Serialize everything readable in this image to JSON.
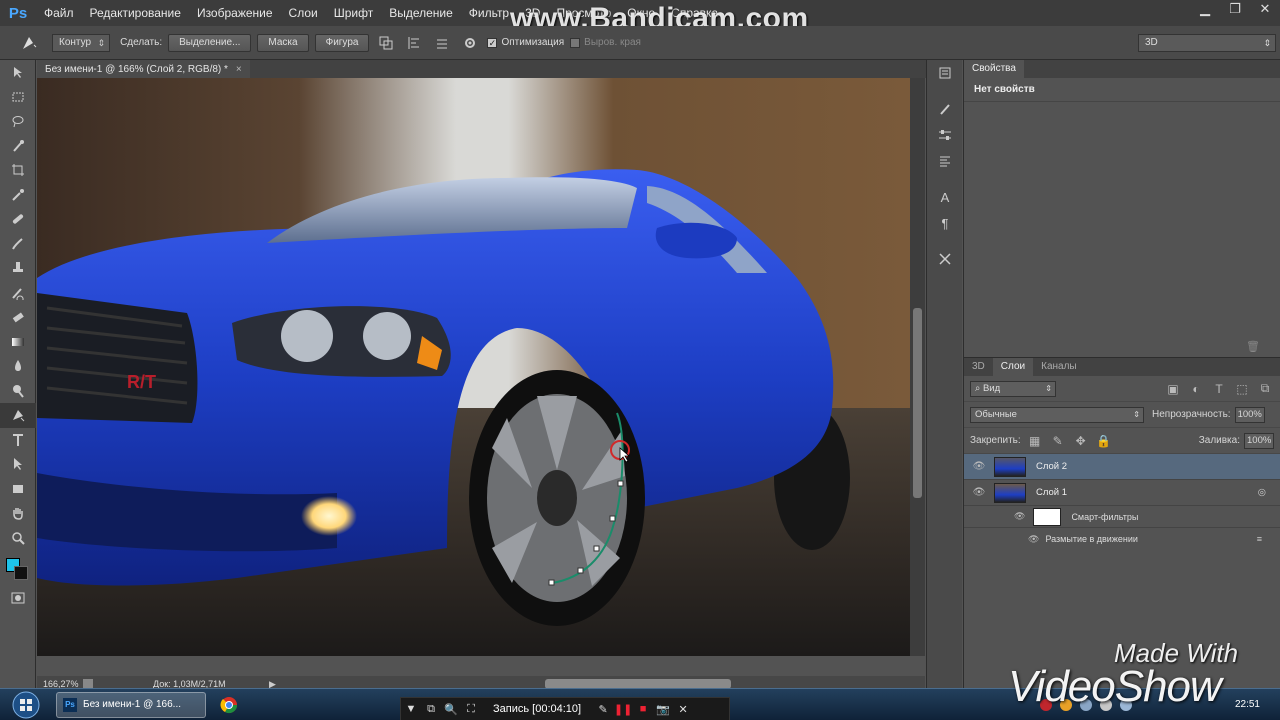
{
  "app": {
    "logo": "Ps"
  },
  "menu": [
    "Файл",
    "Редактирование",
    "Изображение",
    "Слои",
    "Шрифт",
    "Выделение",
    "Фильтр",
    "3D",
    "Просмотр",
    "Окно",
    "Справка"
  ],
  "window_controls": [
    "▁",
    "❐",
    "✕"
  ],
  "watermark_top": "www.Bandicam.com",
  "options": {
    "mode": "Контур",
    "make_label": "Сделать:",
    "selection_btn": "Выделение...",
    "mask_btn": "Маска",
    "shape_btn": "Фигура",
    "optimize_label": "Оптимизация",
    "align_edges_label": "Выров. края",
    "workspace": "3D"
  },
  "document": {
    "tab_title": "Без имени-1 @ 166% (Слой 2, RGB/8) *",
    "close": "×"
  },
  "status": {
    "zoom": "166,27%",
    "doc": "Док: 1,03M/2,71M"
  },
  "properties": {
    "tab": "Свойства",
    "title": "Нет свойств"
  },
  "layers_panel": {
    "tabs": [
      "3D",
      "Слои",
      "Каналы"
    ],
    "filter": "Вид",
    "blend": "Обычные",
    "opacity_label": "Непрозрачность:",
    "opacity": "100%",
    "lock_label": "Закрепить:",
    "fill_label": "Заливка:",
    "fill": "100%",
    "layers": [
      {
        "name": "Слой 2",
        "selected": true
      },
      {
        "name": "Слой 1",
        "selected": false
      }
    ],
    "smart_filters": "Смарт-фильтры",
    "motion_blur": "Размытие в движении"
  },
  "taskbar": {
    "app_button": "Без имени-1 @ 166...",
    "recording": "Запись [00:04:10]",
    "clock": "22:51"
  },
  "watermark_bottom": {
    "line1": "Made With",
    "line2": "VideoShow"
  },
  "colors": {
    "foreground": "#1ec3ea",
    "background": "#111111",
    "car_body": "#1d3ec4",
    "selected_layer": "#56697e"
  },
  "tool_icons": [
    "move-icon",
    "marquee-icon",
    "lasso-icon",
    "quick-select-icon",
    "crop-icon",
    "eyedropper-icon",
    "heal-icon",
    "brush-icon",
    "stamp-icon",
    "history-brush-icon",
    "eraser-icon",
    "gradient-icon",
    "blur-icon",
    "dodge-icon",
    "pen-icon",
    "type-icon",
    "path-select-icon",
    "shape-icon",
    "hand-icon",
    "zoom-icon"
  ]
}
